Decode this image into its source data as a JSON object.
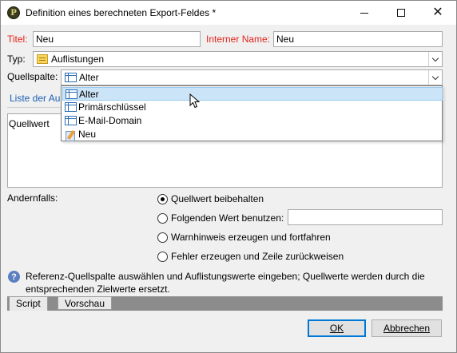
{
  "window": {
    "title": "Definition eines berechneten Export-Feldes *",
    "app_icon_glyph": "P"
  },
  "fields": {
    "titel_label": "Titel:",
    "titel_value": "Neu",
    "interner_name_label": "Interner Name:",
    "interner_name_value": "Neu",
    "typ_label": "Typ:",
    "typ_value": "Auflistungen",
    "quellspalte_label": "Quellspalte:",
    "quellspalte_value": "Alter"
  },
  "dropdown": {
    "items": [
      {
        "label": "Alter",
        "icon": "column-icon",
        "selected": true
      },
      {
        "label": "Primärschlüssel",
        "icon": "column-icon",
        "selected": false
      },
      {
        "label": "E-Mail-Domain",
        "icon": "column-icon",
        "selected": false
      },
      {
        "label": "Neu",
        "icon": "pencil-icon",
        "selected": false
      }
    ]
  },
  "list_tab_label": "Liste der Au",
  "grid": {
    "column_header": "Quellwert"
  },
  "otherwise": {
    "label": "Andernfalls:",
    "options": [
      {
        "label": "Quellwert beibehalten",
        "checked": true
      },
      {
        "label": "Folgenden Wert benutzen:",
        "checked": false
      },
      {
        "label": "Warnhinweis erzeugen und fortfahren",
        "checked": false
      },
      {
        "label": "Fehler erzeugen und Zeile zurückweisen",
        "checked": false
      }
    ],
    "value_input": ""
  },
  "help": {
    "text": "Referenz-Quellspalte auswählen und Auflistungswerte eingeben; Quellwerte werden durch die entsprechenden Zielwerte ersetzt."
  },
  "tabs": [
    "Script",
    "Vorschau"
  ],
  "buttons": {
    "ok": "OK",
    "cancel": "Abbrechen"
  },
  "colors": {
    "required_label": "#e2231a",
    "link_blue": "#1a5fb4",
    "selection": "#cce4f7",
    "default_button_border": "#0078d7"
  }
}
